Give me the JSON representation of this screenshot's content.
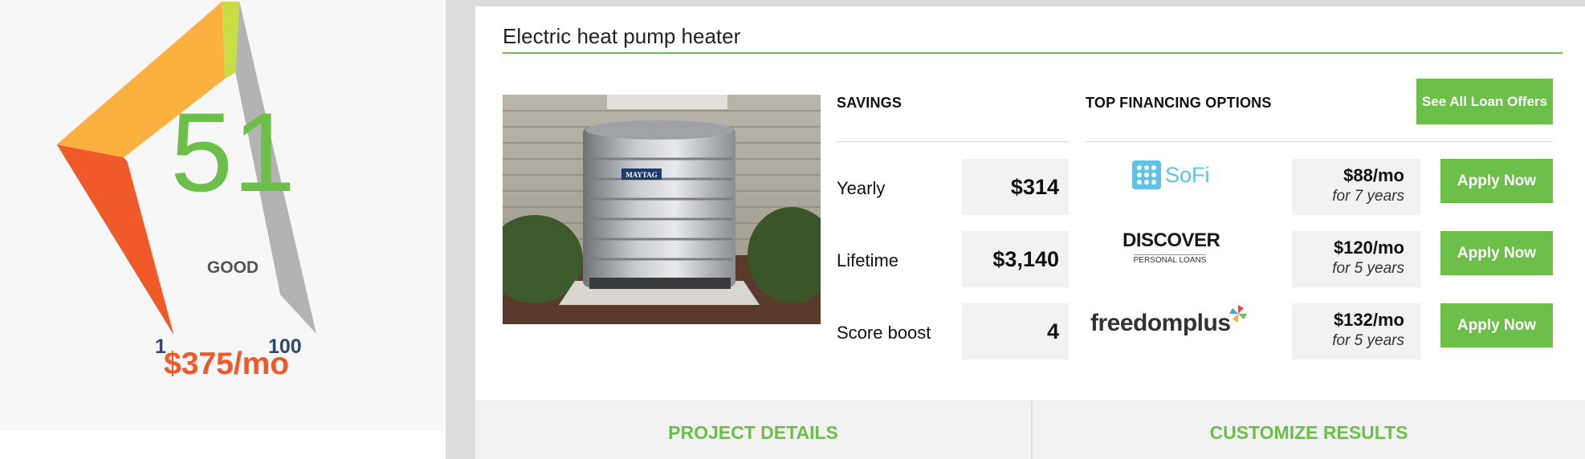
{
  "gauge": {
    "score": "51",
    "rating": "GOOD",
    "min_label": "1",
    "max_label": "100",
    "monthly": "$375/mo",
    "score_color": "#6cc04a",
    "segment_colors": [
      "#f05a28",
      "#fbb040",
      "#c8dd43",
      "#b3b3b3"
    ]
  },
  "product": {
    "title": "Electric heat pump heater",
    "image_alt": "Maytag outdoor heat pump unit",
    "brand_plate": "MAYTAG"
  },
  "savings": {
    "heading": "SAVINGS",
    "rows": [
      {
        "label": "Yearly",
        "value": "$314"
      },
      {
        "label": "Lifetime",
        "value": "$3,140"
      },
      {
        "label": "Score boost",
        "value": "4"
      }
    ]
  },
  "financing": {
    "heading": "TOP FINANCING OPTIONS",
    "see_all_label": "See All Loan Offers",
    "offers": [
      {
        "lender": "SoFi",
        "rate": "$88/mo",
        "term": "for 7 years",
        "button": "Apply Now"
      },
      {
        "lender": "DISCOVER",
        "lender_sub": "PERSONAL LOANS",
        "rate": "$120/mo",
        "term": "for 5 years",
        "button": "Apply Now"
      },
      {
        "lender": "freedomplus",
        "rate": "$132/mo",
        "term": "for 5 years",
        "button": "Apply Now"
      }
    ]
  },
  "tabs": {
    "project_details": "PROJECT DETAILS",
    "customize_results": "CUSTOMIZE RESULTS"
  },
  "colors": {
    "accent_green": "#6cc04a",
    "accent_orange": "#f05a28",
    "navy": "#2c4a74"
  }
}
